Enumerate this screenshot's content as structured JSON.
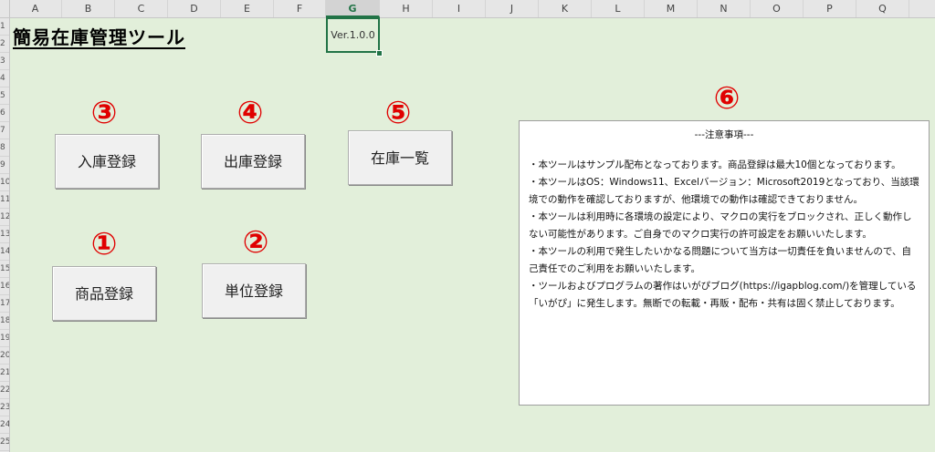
{
  "columns": [
    "A",
    "B",
    "C",
    "D",
    "E",
    "F",
    "G",
    "H",
    "I",
    "J",
    "K",
    "L",
    "M",
    "N",
    "O",
    "P",
    "Q"
  ],
  "rows": [
    "1",
    "2",
    "3",
    "4",
    "5",
    "6",
    "7",
    "8",
    "9",
    "10",
    "11",
    "12",
    "13",
    "14",
    "15",
    "16",
    "17",
    "18",
    "19",
    "20",
    "21",
    "22",
    "23",
    "24",
    "25"
  ],
  "title": "簡易在庫管理ツール",
  "version": "Ver.1.0.0",
  "buttons": {
    "stock_in": {
      "label": "入庫登録",
      "number": "③"
    },
    "stock_out": {
      "label": "出庫登録",
      "number": "④"
    },
    "stock_list": {
      "label": "在庫一覧",
      "number": "⑤"
    },
    "product": {
      "label": "商品登録",
      "number": "①"
    },
    "unit": {
      "label": "単位登録",
      "number": "②"
    }
  },
  "notes": {
    "number": "⑥",
    "title": "---注意事項---",
    "lines": [
      "・本ツールはサンプル配布となっております。商品登録は最大10個となっております。",
      "・本ツールはOS：Windows11、Excelバージョン：Microsoft2019となっており、当該環境での動作を確認しておりますが、他環境での動作は確認できておりません。",
      "・本ツールは利用時に各環境の設定により、マクロの実行をブロックされ、正しく動作しない可能性があります。ご自身でのマクロ実行の許可設定をお願いいたします。",
      "・本ツールの利用で発生したいかなる問題について当方は一切責任を負いませんので、自己責任でのご利用をお願いいたします。",
      "・ツールおよびプログラムの著作はいがぴブログ(https://igapblog.com/)を管理している「いがぴ」に発生します。無断での転載・再販・配布・共有は固く禁止しております。"
    ]
  },
  "colors": {
    "sheet_bg": "#e2efda",
    "accent": "#217346",
    "number_red": "#e00000"
  }
}
